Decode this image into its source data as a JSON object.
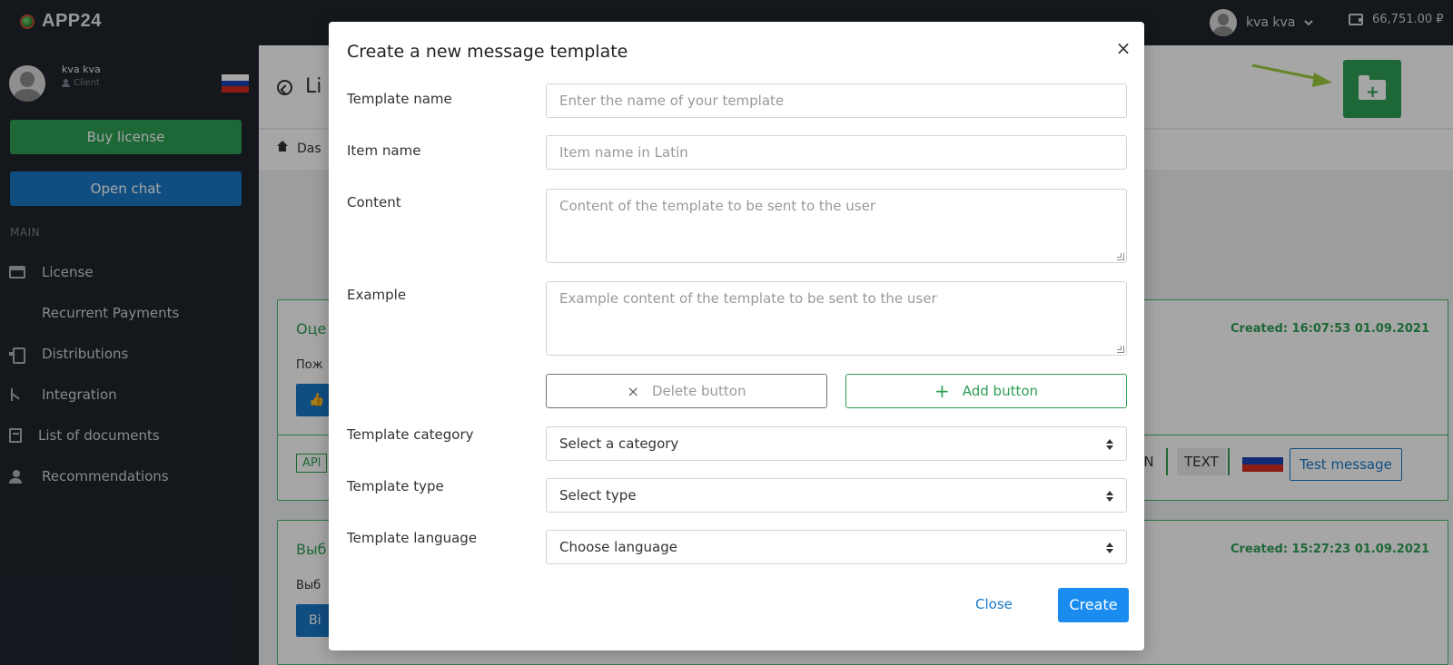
{
  "topbar": {
    "brand": "APP24",
    "user_name": "kva kva",
    "balance": "66,751.00 ₽"
  },
  "sidebar": {
    "profile_name": "kva kva",
    "profile_role": "Client",
    "buy_license": "Buy license",
    "open_chat": "Open chat",
    "section_main": "MAIN",
    "items": [
      {
        "label": "License",
        "icon": "store-icon"
      },
      {
        "label": "Recurrent Payments",
        "icon": "card-icon"
      },
      {
        "label": "Distributions",
        "icon": "distribution-icon"
      },
      {
        "label": "Integration",
        "icon": "integration-icon"
      },
      {
        "label": "List of documents",
        "icon": "documents-icon"
      },
      {
        "label": "Recommendations",
        "icon": "recommendations-icon"
      }
    ]
  },
  "main": {
    "title_partial": "Li",
    "breadcrumb_partial": "Das",
    "cards": [
      {
        "title_partial": "Оце",
        "date": "Created: 16:07:53 01.09.2021",
        "body_partial": "Пож",
        "button_partial": "👍",
        "tag_app": "APl",
        "tag_category": "TION",
        "tag_type": "TEXT",
        "test_button": "Test message"
      },
      {
        "title_partial": "Выб",
        "date": "Created: 15:27:23 01.09.2021",
        "body_partial": "Выб",
        "button_partial": "Bi"
      }
    ]
  },
  "modal": {
    "title": "Create a new message template",
    "close_glyph": "×",
    "fields": {
      "template_name_label": "Template name",
      "template_name_placeholder": "Enter the name of your template",
      "item_name_label": "Item name",
      "item_name_placeholder": "Item name in Latin",
      "content_label": "Content",
      "content_placeholder": "Content of the template to be sent to the user",
      "example_label": "Example",
      "example_placeholder": "Example content of the template to be sent to the user",
      "category_label": "Template category",
      "category_value": "Select a category",
      "type_label": "Template type",
      "type_value": "Select type",
      "language_label": "Template language",
      "language_value": "Choose language"
    },
    "delete_button": "Delete button",
    "add_button": "Add button",
    "close_button": "Close",
    "create_button": "Create"
  },
  "colors": {
    "sidebar_bg": "#1f242c",
    "green": "#2f9e53",
    "blue": "#1a78c8",
    "create_blue": "#1a8cf0"
  }
}
